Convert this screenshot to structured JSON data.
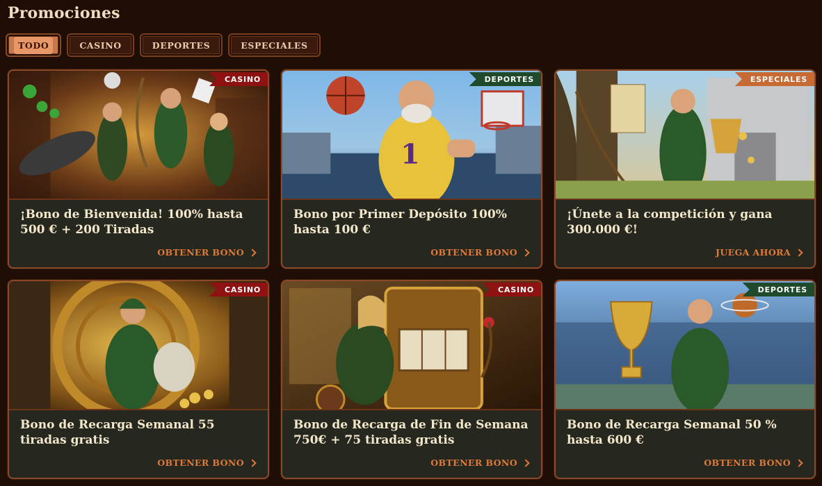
{
  "page": {
    "title": "Promociones"
  },
  "filters": [
    {
      "label": "TODO",
      "active": true
    },
    {
      "label": "CASINO",
      "active": false
    },
    {
      "label": "DEPORTES",
      "active": false
    },
    {
      "label": "ESPECIALES",
      "active": false
    }
  ],
  "colors": {
    "background": "#1f0e06",
    "card_background": "#26271e",
    "accent": "#e07a3a",
    "badge_casino": "#8e1212",
    "badge_deportes": "#1f4a2c",
    "badge_especiales": "#c76a34"
  },
  "promotions": [
    {
      "badge": "CASINO",
      "title": "¡Bono de Bienvenida! 100% hasta 500 € + 200 Tiradas",
      "cta": "OBTENER BONO",
      "image": "hero-cannon-archers"
    },
    {
      "badge": "DEPORTES",
      "title": "Bono por Primer Depósito 100% hasta 100 €",
      "cta": "OBTENER BONO",
      "image": "basketball-player-sherwood"
    },
    {
      "badge": "ESPECIALES",
      "title": "¡Únete a la competición y gana 300.000 €!",
      "cta": "JUEGA AHORA",
      "image": "archer-with-trophy"
    },
    {
      "badge": "CASINO",
      "title": "Bono de Recarga Semanal 55 tiradas gratis",
      "cta": "OBTENER BONO",
      "image": "vault-gold-bag"
    },
    {
      "badge": "CASINO",
      "title": "Bono de Recarga de Fin de Semana 750€ + 75 tiradas gratis",
      "cta": "OBTENER BONO",
      "image": "slot-machine-archer"
    },
    {
      "badge": "DEPORTES",
      "title": "Bono de Recarga Semanal 50 % hasta 600 €",
      "cta": "OBTENER BONO",
      "image": "trophy-stadium-ball"
    }
  ]
}
